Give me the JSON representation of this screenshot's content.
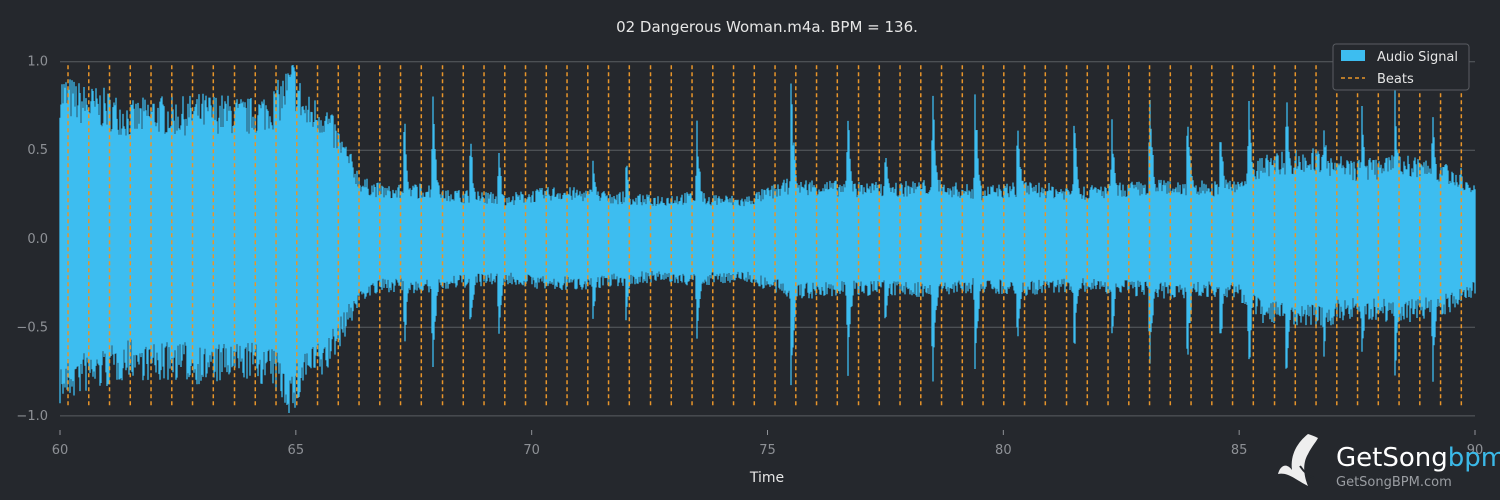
{
  "chart_data": {
    "type": "area",
    "title": "02 Dangerous Woman.m4a. BPM = 136.",
    "xlabel": "Time",
    "ylabel": "",
    "xlim": [
      60,
      90
    ],
    "ylim": [
      -1.08,
      1.1
    ],
    "x_ticks": [
      60,
      65,
      70,
      75,
      80,
      85,
      90
    ],
    "y_ticks": [
      -1.0,
      -0.5,
      0.0,
      0.5,
      1.0
    ],
    "x_tick_labels": [
      "60",
      "65",
      "70",
      "75",
      "80",
      "85",
      "90"
    ],
    "y_tick_labels": [
      "−1.0",
      "−0.5",
      "0.0",
      "0.5",
      "1.0"
    ],
    "grid": "horizontal",
    "legend_position": "top-right",
    "bpm": 136,
    "series": [
      {
        "name": "Audio Signal",
        "kind": "waveform",
        "color": "#3dbdf0",
        "x_range": [
          60.0,
          90.0
        ],
        "envelope_points": [
          {
            "x": 60.0,
            "amp": 0.95
          },
          {
            "x": 60.5,
            "amp": 0.88
          },
          {
            "x": 61.0,
            "amp": 0.85
          },
          {
            "x": 61.5,
            "amp": 0.78
          },
          {
            "x": 62.0,
            "amp": 0.82
          },
          {
            "x": 62.5,
            "amp": 0.8
          },
          {
            "x": 63.0,
            "amp": 0.83
          },
          {
            "x": 63.5,
            "amp": 0.82
          },
          {
            "x": 64.0,
            "amp": 0.8
          },
          {
            "x": 64.5,
            "amp": 0.85
          },
          {
            "x": 64.95,
            "amp": 1.03
          },
          {
            "x": 65.2,
            "amp": 0.82
          },
          {
            "x": 65.6,
            "amp": 0.8
          },
          {
            "x": 66.0,
            "amp": 0.58
          },
          {
            "x": 66.4,
            "amp": 0.35
          },
          {
            "x": 67.0,
            "amp": 0.3
          },
          {
            "x": 67.8,
            "amp": 0.32
          },
          {
            "x": 68.5,
            "amp": 0.28
          },
          {
            "x": 69.5,
            "amp": 0.26
          },
          {
            "x": 70.5,
            "amp": 0.3
          },
          {
            "x": 71.5,
            "amp": 0.28
          },
          {
            "x": 72.5,
            "amp": 0.25
          },
          {
            "x": 73.5,
            "amp": 0.27
          },
          {
            "x": 74.5,
            "amp": 0.24
          },
          {
            "x": 75.5,
            "amp": 0.35
          },
          {
            "x": 76.5,
            "amp": 0.33
          },
          {
            "x": 77.5,
            "amp": 0.32
          },
          {
            "x": 78.5,
            "amp": 0.34
          },
          {
            "x": 79.5,
            "amp": 0.3
          },
          {
            "x": 80.5,
            "amp": 0.33
          },
          {
            "x": 81.5,
            "amp": 0.3
          },
          {
            "x": 82.5,
            "amp": 0.32
          },
          {
            "x": 83.5,
            "amp": 0.34
          },
          {
            "x": 84.5,
            "amp": 0.33
          },
          {
            "x": 85.0,
            "amp": 0.35
          },
          {
            "x": 85.5,
            "amp": 0.48
          },
          {
            "x": 86.5,
            "amp": 0.52
          },
          {
            "x": 87.5,
            "amp": 0.45
          },
          {
            "x": 88.5,
            "amp": 0.48
          },
          {
            "x": 89.5,
            "amp": 0.42
          },
          {
            "x": 90.0,
            "amp": 0.32
          }
        ],
        "transient_peaks": [
          {
            "x": 67.3,
            "top": 0.75,
            "bottom": -0.7
          },
          {
            "x": 67.9,
            "top": 0.88,
            "bottom": -0.85
          },
          {
            "x": 68.7,
            "top": 0.62,
            "bottom": -0.62
          },
          {
            "x": 69.3,
            "top": 0.55,
            "bottom": -0.6
          },
          {
            "x": 71.3,
            "top": 0.55,
            "bottom": -0.55
          },
          {
            "x": 72.0,
            "top": 0.5,
            "bottom": -0.5
          },
          {
            "x": 73.5,
            "top": 0.7,
            "bottom": -0.68
          },
          {
            "x": 75.5,
            "top": 0.92,
            "bottom": -0.9
          },
          {
            "x": 76.7,
            "top": 0.82,
            "bottom": -0.86
          },
          {
            "x": 77.5,
            "top": 0.6,
            "bottom": -0.6
          },
          {
            "x": 78.5,
            "top": 0.9,
            "bottom": -0.88
          },
          {
            "x": 79.4,
            "top": 0.9,
            "bottom": -0.82
          },
          {
            "x": 80.3,
            "top": 0.75,
            "bottom": -0.7
          },
          {
            "x": 81.5,
            "top": 0.82,
            "bottom": -0.72
          },
          {
            "x": 82.3,
            "top": 0.7,
            "bottom": -0.66
          },
          {
            "x": 83.1,
            "top": 0.88,
            "bottom": -0.85
          },
          {
            "x": 83.9,
            "top": 0.85,
            "bottom": -0.8
          },
          {
            "x": 84.6,
            "top": 0.75,
            "bottom": -0.72
          },
          {
            "x": 85.2,
            "top": 0.88,
            "bottom": -0.88
          },
          {
            "x": 86.0,
            "top": 0.9,
            "bottom": -0.9
          },
          {
            "x": 86.8,
            "top": 0.75,
            "bottom": -0.72
          },
          {
            "x": 87.6,
            "top": 0.78,
            "bottom": -0.8
          },
          {
            "x": 88.3,
            "top": 0.9,
            "bottom": -0.85
          },
          {
            "x": 89.1,
            "top": 0.85,
            "bottom": -0.88
          },
          {
            "x": 89.7,
            "top": 0.45,
            "bottom": -0.35
          }
        ]
      },
      {
        "name": "Beats",
        "kind": "vertical-dashed-lines",
        "color": "#e8952a",
        "x": [
          60.17,
          60.61,
          61.05,
          61.49,
          61.93,
          62.37,
          62.81,
          63.25,
          63.7,
          64.14,
          64.58,
          65.02,
          65.46,
          65.9,
          66.34,
          66.78,
          67.22,
          67.66,
          68.11,
          68.55,
          68.99,
          69.43,
          69.87,
          70.31,
          70.75,
          71.19,
          71.63,
          72.07,
          72.52,
          72.96,
          73.4,
          73.84,
          74.28,
          74.72,
          75.16,
          75.6,
          76.04,
          76.48,
          76.93,
          77.37,
          77.81,
          78.25,
          78.69,
          79.13,
          79.57,
          80.01,
          80.45,
          80.89,
          81.34,
          81.78,
          82.22,
          82.66,
          83.1,
          83.54,
          83.98,
          84.42,
          84.86,
          85.3,
          85.75,
          86.19,
          86.63,
          87.07,
          87.51,
          87.95,
          88.39,
          88.83,
          89.27,
          89.71
        ],
        "ymin": -0.95,
        "ymax": 0.98
      }
    ]
  },
  "watermark": {
    "brand_main": "GetSong",
    "brand_accent": "bpm",
    "brand_url": "GetSongBPM.com",
    "icon_name": "bird-logo-icon"
  }
}
